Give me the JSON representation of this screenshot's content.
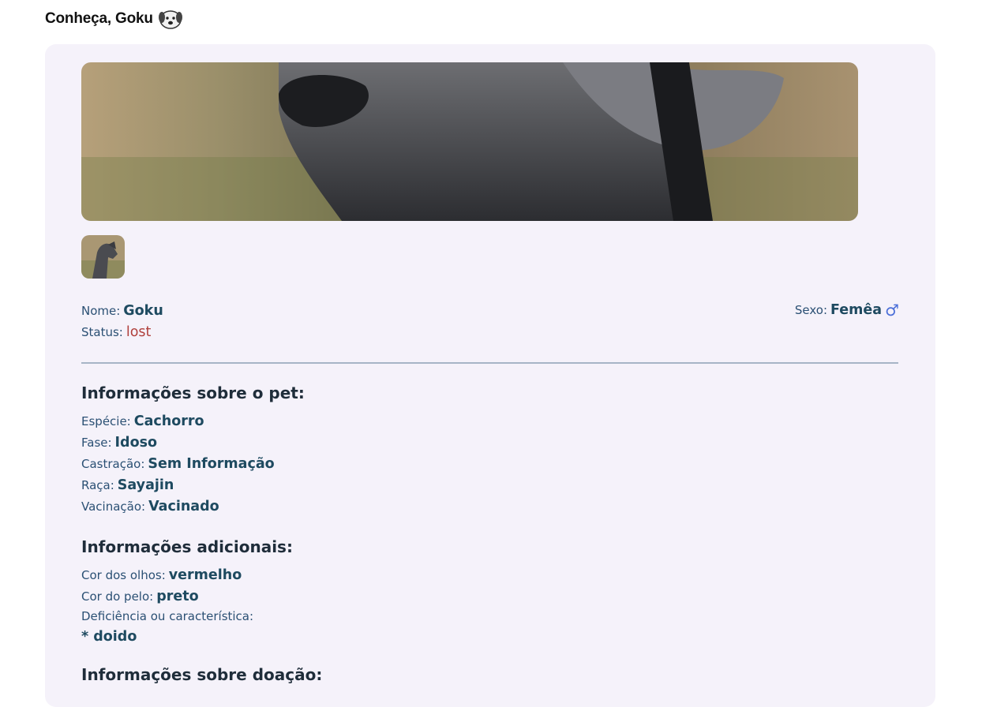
{
  "header": {
    "title": "Conheça, Goku",
    "icon": "dog-face-icon"
  },
  "pet": {
    "name_label": "Nome:",
    "name": "Goku",
    "status_label": "Status:",
    "status": "lost",
    "sex_label": "Sexo:",
    "sex": "Femêa",
    "sex_icon": "♂"
  },
  "pet_info": {
    "heading": "Informações sobre o pet:",
    "especie_label": "Espécie:",
    "especie": "Cachorro",
    "fase_label": "Fase:",
    "fase": "Idoso",
    "castracao_label": "Castração:",
    "castracao": "Sem Informação",
    "raca_label": "Raça:",
    "raca": "Sayajin",
    "vacinacao_label": "Vacinação:",
    "vacinacao": "Vacinado"
  },
  "extra_info": {
    "heading": "Informações adicionais:",
    "olhos_label": "Cor dos olhos:",
    "olhos": "vermelho",
    "pelo_label": "Cor do pelo:",
    "pelo": "preto",
    "deficiencia_label": "Deficiência ou característica:",
    "deficiencia": "* doido"
  },
  "donation_info": {
    "heading": "Informações sobre doação:"
  },
  "colors": {
    "card_bg": "#f5f2fa",
    "value": "#1e4a60",
    "label": "#2b5074",
    "status": "#b0403c",
    "male_icon": "#4b6fd8"
  }
}
